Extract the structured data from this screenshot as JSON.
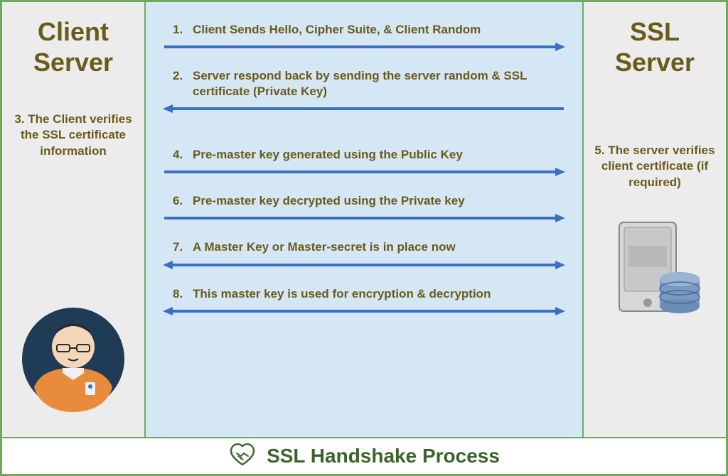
{
  "left": {
    "title_line1": "Client",
    "title_line2": "Server",
    "note": "3. The Client verifies the SSL certificate information"
  },
  "right": {
    "title_line1": "SSL",
    "title_line2": "Server",
    "note": "5. The server verifies client certificate (if required)"
  },
  "steps": [
    {
      "num": "1.",
      "text": "Client Sends Hello, Cipher Suite, & Client Random",
      "dir": "right"
    },
    {
      "num": "2.",
      "text": "Server respond back by sending the server random & SSL certificate (Private Key)",
      "dir": "left"
    },
    {
      "num": "4.",
      "text": "Pre-master key generated using the Public Key",
      "dir": "right"
    },
    {
      "num": "6.",
      "text": "Pre-master key decrypted using the Private key",
      "dir": "right"
    },
    {
      "num": "7.",
      "text": "A Master Key or Master-secret is in place now",
      "dir": "both"
    },
    {
      "num": "8.",
      "text": "This master key is used for encryption & decryption",
      "dir": "both"
    }
  ],
  "footer": {
    "title": "SSL Handshake Process"
  },
  "colors": {
    "arrow": "#3A6FC4",
    "text": "#6B5B1A",
    "accent": "#3D632C"
  }
}
